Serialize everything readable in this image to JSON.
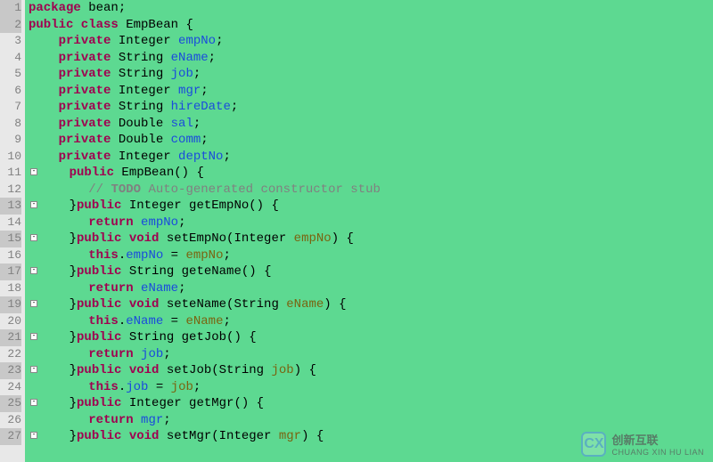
{
  "lines": [
    {
      "num": "1",
      "hl": true,
      "tokens": [
        [
          "kw",
          "package"
        ],
        [
          "str",
          " bean;"
        ]
      ]
    },
    {
      "num": "2",
      "hl": true,
      "tokens": [
        [
          "kw",
          "public class"
        ],
        [
          "str",
          " EmpBean {"
        ]
      ]
    },
    {
      "num": "3",
      "hl": false,
      "indent": "    ",
      "tokens": [
        [
          "kw",
          "private"
        ],
        [
          "str",
          " Integer "
        ],
        [
          "ident",
          "empNo"
        ],
        [
          "str",
          ";"
        ]
      ]
    },
    {
      "num": "4",
      "hl": false,
      "indent": "    ",
      "tokens": [
        [
          "kw",
          "private"
        ],
        [
          "str",
          " String "
        ],
        [
          "ident",
          "eName"
        ],
        [
          "str",
          ";"
        ]
      ]
    },
    {
      "num": "5",
      "hl": false,
      "indent": "    ",
      "tokens": [
        [
          "kw",
          "private"
        ],
        [
          "str",
          " String "
        ],
        [
          "ident",
          "job"
        ],
        [
          "str",
          ";"
        ]
      ]
    },
    {
      "num": "6",
      "hl": false,
      "indent": "    ",
      "tokens": [
        [
          "kw",
          "private"
        ],
        [
          "str",
          " Integer "
        ],
        [
          "ident",
          "mgr"
        ],
        [
          "str",
          ";"
        ]
      ]
    },
    {
      "num": "7",
      "hl": false,
      "indent": "    ",
      "tokens": [
        [
          "kw",
          "private"
        ],
        [
          "str",
          " String "
        ],
        [
          "ident",
          "hireDate"
        ],
        [
          "str",
          ";"
        ]
      ]
    },
    {
      "num": "8",
      "hl": false,
      "indent": "    ",
      "tokens": [
        [
          "kw",
          "private"
        ],
        [
          "str",
          " Double "
        ],
        [
          "ident",
          "sal"
        ],
        [
          "str",
          ";"
        ]
      ]
    },
    {
      "num": "9",
      "hl": false,
      "indent": "    ",
      "tokens": [
        [
          "kw",
          "private"
        ],
        [
          "str",
          " Double "
        ],
        [
          "ident",
          "comm"
        ],
        [
          "str",
          ";"
        ]
      ]
    },
    {
      "num": "10",
      "hl": false,
      "indent": "    ",
      "tokens": [
        [
          "kw",
          "private"
        ],
        [
          "str",
          " Integer "
        ],
        [
          "ident",
          "deptNo"
        ],
        [
          "str",
          ";"
        ]
      ]
    },
    {
      "num": "11",
      "hl": false,
      "fold": true,
      "indent": "    ",
      "tokens": [
        [
          "kw",
          "public"
        ],
        [
          "str",
          " EmpBean() {"
        ]
      ]
    },
    {
      "num": "12",
      "hl": false,
      "indent": "        ",
      "tokens": [
        [
          "comment",
          "// "
        ],
        [
          "todo",
          "TODO"
        ],
        [
          "comment",
          " Auto-generated constructor stub"
        ]
      ]
    },
    {
      "num": "13",
      "hl": true,
      "fold": true,
      "indent": "    ",
      "tokens": [
        [
          "str",
          "}"
        ],
        [
          "kw",
          "public"
        ],
        [
          "str",
          " Integer getEmpNo() {"
        ]
      ]
    },
    {
      "num": "14",
      "hl": false,
      "indent": "        ",
      "tokens": [
        [
          "kw",
          "return"
        ],
        [
          "str",
          " "
        ],
        [
          "ident",
          "empNo"
        ],
        [
          "str",
          ";"
        ]
      ]
    },
    {
      "num": "15",
      "hl": true,
      "fold": true,
      "indent": "    ",
      "tokens": [
        [
          "str",
          "}"
        ],
        [
          "kw",
          "public void"
        ],
        [
          "str",
          " setEmpNo(Integer "
        ],
        [
          "param",
          "empNo"
        ],
        [
          "str",
          ") {"
        ]
      ]
    },
    {
      "num": "16",
      "hl": false,
      "indent": "        ",
      "tokens": [
        [
          "kw",
          "this"
        ],
        [
          "str",
          "."
        ],
        [
          "ident",
          "empNo"
        ],
        [
          "str",
          " = "
        ],
        [
          "param",
          "empNo"
        ],
        [
          "str",
          ";"
        ]
      ]
    },
    {
      "num": "17",
      "hl": true,
      "fold": true,
      "indent": "    ",
      "tokens": [
        [
          "str",
          "}"
        ],
        [
          "kw",
          "public"
        ],
        [
          "str",
          " String geteName() {"
        ]
      ]
    },
    {
      "num": "18",
      "hl": false,
      "indent": "        ",
      "tokens": [
        [
          "kw",
          "return"
        ],
        [
          "str",
          " "
        ],
        [
          "ident",
          "eName"
        ],
        [
          "str",
          ";"
        ]
      ]
    },
    {
      "num": "19",
      "hl": true,
      "fold": true,
      "indent": "    ",
      "tokens": [
        [
          "str",
          "}"
        ],
        [
          "kw",
          "public void"
        ],
        [
          "str",
          " seteName(String "
        ],
        [
          "param",
          "eName"
        ],
        [
          "str",
          ") {"
        ]
      ]
    },
    {
      "num": "20",
      "hl": false,
      "indent": "        ",
      "tokens": [
        [
          "kw",
          "this"
        ],
        [
          "str",
          "."
        ],
        [
          "ident",
          "eName"
        ],
        [
          "str",
          " = "
        ],
        [
          "param",
          "eName"
        ],
        [
          "str",
          ";"
        ]
      ]
    },
    {
      "num": "21",
      "hl": true,
      "fold": true,
      "indent": "    ",
      "tokens": [
        [
          "str",
          "}"
        ],
        [
          "kw",
          "public"
        ],
        [
          "str",
          " String getJob() {"
        ]
      ]
    },
    {
      "num": "22",
      "hl": false,
      "indent": "        ",
      "tokens": [
        [
          "kw",
          "return"
        ],
        [
          "str",
          " "
        ],
        [
          "ident",
          "job"
        ],
        [
          "str",
          ";"
        ]
      ]
    },
    {
      "num": "23",
      "hl": true,
      "fold": true,
      "indent": "    ",
      "tokens": [
        [
          "str",
          "}"
        ],
        [
          "kw",
          "public void"
        ],
        [
          "str",
          " setJob(String "
        ],
        [
          "param",
          "job"
        ],
        [
          "str",
          ") {"
        ]
      ]
    },
    {
      "num": "24",
      "hl": false,
      "indent": "        ",
      "tokens": [
        [
          "kw",
          "this"
        ],
        [
          "str",
          "."
        ],
        [
          "ident",
          "job"
        ],
        [
          "str",
          " = "
        ],
        [
          "param",
          "job"
        ],
        [
          "str",
          ";"
        ]
      ]
    },
    {
      "num": "25",
      "hl": true,
      "fold": true,
      "indent": "    ",
      "tokens": [
        [
          "str",
          "}"
        ],
        [
          "kw",
          "public"
        ],
        [
          "str",
          " Integer getMgr() {"
        ]
      ]
    },
    {
      "num": "26",
      "hl": false,
      "indent": "        ",
      "tokens": [
        [
          "kw",
          "return"
        ],
        [
          "str",
          " "
        ],
        [
          "ident",
          "mgr"
        ],
        [
          "str",
          ";"
        ]
      ]
    },
    {
      "num": "27",
      "hl": true,
      "fold": true,
      "indent": "    ",
      "tokens": [
        [
          "str",
          "}"
        ],
        [
          "kw",
          "public void"
        ],
        [
          "str",
          " setMgr(Integer "
        ],
        [
          "param",
          "mgr"
        ],
        [
          "str",
          ") {"
        ]
      ]
    }
  ],
  "watermark": {
    "logo": "CX",
    "cn": "创新互联",
    "en": "CHUANG XIN HU LIAN"
  }
}
